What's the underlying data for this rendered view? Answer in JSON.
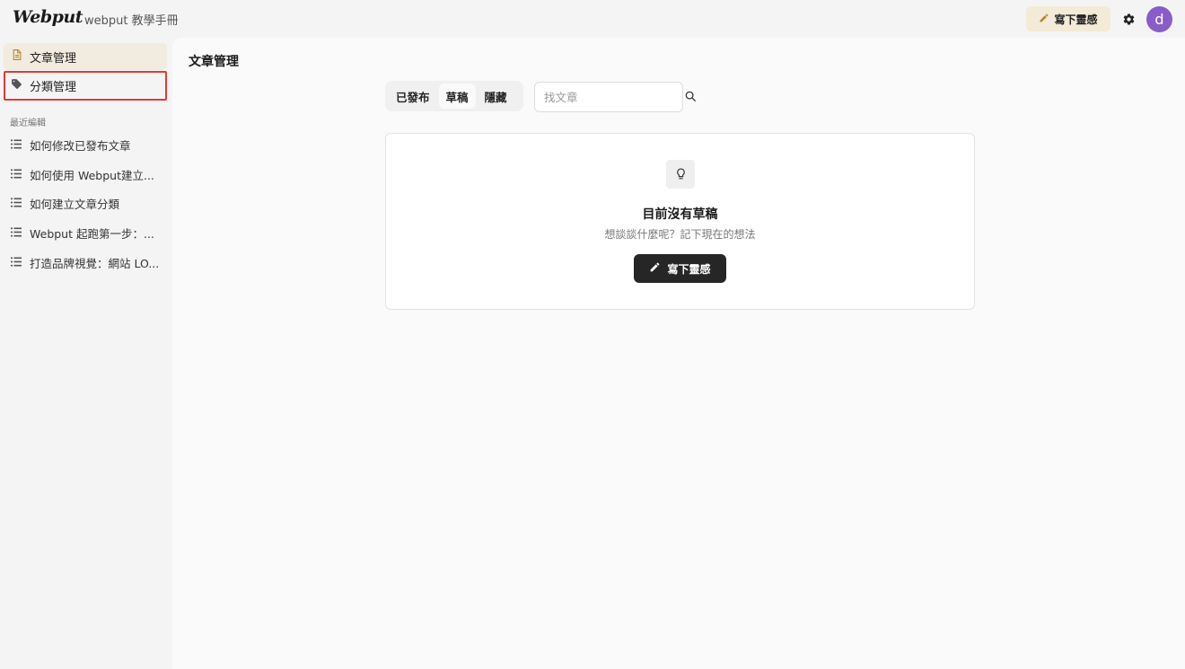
{
  "header": {
    "logo": "Webput",
    "site_name": "webput 教學手冊",
    "write_button": "寫下靈感",
    "avatar_letter": "d"
  },
  "sidebar": {
    "items": [
      {
        "label": "文章管理",
        "icon": "document-icon"
      },
      {
        "label": "分類管理",
        "icon": "tag-icon"
      }
    ],
    "recent_label": "最近編輯",
    "recent": [
      "如何修改已發布文章",
      "如何使用 Webput建立...",
      "如何建立文章分類",
      "Webput 起跑第一步：...",
      "打造品牌視覺：網站 LO..."
    ]
  },
  "main": {
    "title": "文章管理",
    "tabs": [
      "已發布",
      "草稿",
      "隱藏"
    ],
    "active_tab": "草稿",
    "search_placeholder": "找文章",
    "empty": {
      "title": "目前沒有草稿",
      "subtitle": "想談談什麼呢？記下現在的想法",
      "button": "寫下靈感"
    }
  },
  "colors": {
    "accent_bg": "#f3ead7",
    "avatar": "#8a5cc7",
    "highlight_border": "#e03a36",
    "primary_button": "#262626"
  }
}
